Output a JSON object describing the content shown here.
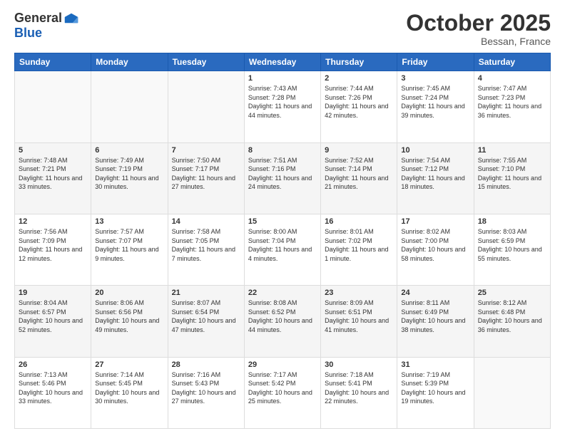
{
  "header": {
    "logo_general": "General",
    "logo_blue": "Blue",
    "month": "October 2025",
    "location": "Bessan, France"
  },
  "weekdays": [
    "Sunday",
    "Monday",
    "Tuesday",
    "Wednesday",
    "Thursday",
    "Friday",
    "Saturday"
  ],
  "weeks": [
    [
      {
        "day": "",
        "sunrise": "",
        "sunset": "",
        "daylight": ""
      },
      {
        "day": "",
        "sunrise": "",
        "sunset": "",
        "daylight": ""
      },
      {
        "day": "",
        "sunrise": "",
        "sunset": "",
        "daylight": ""
      },
      {
        "day": "1",
        "sunrise": "Sunrise: 7:43 AM",
        "sunset": "Sunset: 7:28 PM",
        "daylight": "Daylight: 11 hours and 44 minutes."
      },
      {
        "day": "2",
        "sunrise": "Sunrise: 7:44 AM",
        "sunset": "Sunset: 7:26 PM",
        "daylight": "Daylight: 11 hours and 42 minutes."
      },
      {
        "day": "3",
        "sunrise": "Sunrise: 7:45 AM",
        "sunset": "Sunset: 7:24 PM",
        "daylight": "Daylight: 11 hours and 39 minutes."
      },
      {
        "day": "4",
        "sunrise": "Sunrise: 7:47 AM",
        "sunset": "Sunset: 7:23 PM",
        "daylight": "Daylight: 11 hours and 36 minutes."
      }
    ],
    [
      {
        "day": "5",
        "sunrise": "Sunrise: 7:48 AM",
        "sunset": "Sunset: 7:21 PM",
        "daylight": "Daylight: 11 hours and 33 minutes."
      },
      {
        "day": "6",
        "sunrise": "Sunrise: 7:49 AM",
        "sunset": "Sunset: 7:19 PM",
        "daylight": "Daylight: 11 hours and 30 minutes."
      },
      {
        "day": "7",
        "sunrise": "Sunrise: 7:50 AM",
        "sunset": "Sunset: 7:17 PM",
        "daylight": "Daylight: 11 hours and 27 minutes."
      },
      {
        "day": "8",
        "sunrise": "Sunrise: 7:51 AM",
        "sunset": "Sunset: 7:16 PM",
        "daylight": "Daylight: 11 hours and 24 minutes."
      },
      {
        "day": "9",
        "sunrise": "Sunrise: 7:52 AM",
        "sunset": "Sunset: 7:14 PM",
        "daylight": "Daylight: 11 hours and 21 minutes."
      },
      {
        "day": "10",
        "sunrise": "Sunrise: 7:54 AM",
        "sunset": "Sunset: 7:12 PM",
        "daylight": "Daylight: 11 hours and 18 minutes."
      },
      {
        "day": "11",
        "sunrise": "Sunrise: 7:55 AM",
        "sunset": "Sunset: 7:10 PM",
        "daylight": "Daylight: 11 hours and 15 minutes."
      }
    ],
    [
      {
        "day": "12",
        "sunrise": "Sunrise: 7:56 AM",
        "sunset": "Sunset: 7:09 PM",
        "daylight": "Daylight: 11 hours and 12 minutes."
      },
      {
        "day": "13",
        "sunrise": "Sunrise: 7:57 AM",
        "sunset": "Sunset: 7:07 PM",
        "daylight": "Daylight: 11 hours and 9 minutes."
      },
      {
        "day": "14",
        "sunrise": "Sunrise: 7:58 AM",
        "sunset": "Sunset: 7:05 PM",
        "daylight": "Daylight: 11 hours and 7 minutes."
      },
      {
        "day": "15",
        "sunrise": "Sunrise: 8:00 AM",
        "sunset": "Sunset: 7:04 PM",
        "daylight": "Daylight: 11 hours and 4 minutes."
      },
      {
        "day": "16",
        "sunrise": "Sunrise: 8:01 AM",
        "sunset": "Sunset: 7:02 PM",
        "daylight": "Daylight: 11 hours and 1 minute."
      },
      {
        "day": "17",
        "sunrise": "Sunrise: 8:02 AM",
        "sunset": "Sunset: 7:00 PM",
        "daylight": "Daylight: 10 hours and 58 minutes."
      },
      {
        "day": "18",
        "sunrise": "Sunrise: 8:03 AM",
        "sunset": "Sunset: 6:59 PM",
        "daylight": "Daylight: 10 hours and 55 minutes."
      }
    ],
    [
      {
        "day": "19",
        "sunrise": "Sunrise: 8:04 AM",
        "sunset": "Sunset: 6:57 PM",
        "daylight": "Daylight: 10 hours and 52 minutes."
      },
      {
        "day": "20",
        "sunrise": "Sunrise: 8:06 AM",
        "sunset": "Sunset: 6:56 PM",
        "daylight": "Daylight: 10 hours and 49 minutes."
      },
      {
        "day": "21",
        "sunrise": "Sunrise: 8:07 AM",
        "sunset": "Sunset: 6:54 PM",
        "daylight": "Daylight: 10 hours and 47 minutes."
      },
      {
        "day": "22",
        "sunrise": "Sunrise: 8:08 AM",
        "sunset": "Sunset: 6:52 PM",
        "daylight": "Daylight: 10 hours and 44 minutes."
      },
      {
        "day": "23",
        "sunrise": "Sunrise: 8:09 AM",
        "sunset": "Sunset: 6:51 PM",
        "daylight": "Daylight: 10 hours and 41 minutes."
      },
      {
        "day": "24",
        "sunrise": "Sunrise: 8:11 AM",
        "sunset": "Sunset: 6:49 PM",
        "daylight": "Daylight: 10 hours and 38 minutes."
      },
      {
        "day": "25",
        "sunrise": "Sunrise: 8:12 AM",
        "sunset": "Sunset: 6:48 PM",
        "daylight": "Daylight: 10 hours and 36 minutes."
      }
    ],
    [
      {
        "day": "26",
        "sunrise": "Sunrise: 7:13 AM",
        "sunset": "Sunset: 5:46 PM",
        "daylight": "Daylight: 10 hours and 33 minutes."
      },
      {
        "day": "27",
        "sunrise": "Sunrise: 7:14 AM",
        "sunset": "Sunset: 5:45 PM",
        "daylight": "Daylight: 10 hours and 30 minutes."
      },
      {
        "day": "28",
        "sunrise": "Sunrise: 7:16 AM",
        "sunset": "Sunset: 5:43 PM",
        "daylight": "Daylight: 10 hours and 27 minutes."
      },
      {
        "day": "29",
        "sunrise": "Sunrise: 7:17 AM",
        "sunset": "Sunset: 5:42 PM",
        "daylight": "Daylight: 10 hours and 25 minutes."
      },
      {
        "day": "30",
        "sunrise": "Sunrise: 7:18 AM",
        "sunset": "Sunset: 5:41 PM",
        "daylight": "Daylight: 10 hours and 22 minutes."
      },
      {
        "day": "31",
        "sunrise": "Sunrise: 7:19 AM",
        "sunset": "Sunset: 5:39 PM",
        "daylight": "Daylight: 10 hours and 19 minutes."
      },
      {
        "day": "",
        "sunrise": "",
        "sunset": "",
        "daylight": ""
      }
    ]
  ]
}
